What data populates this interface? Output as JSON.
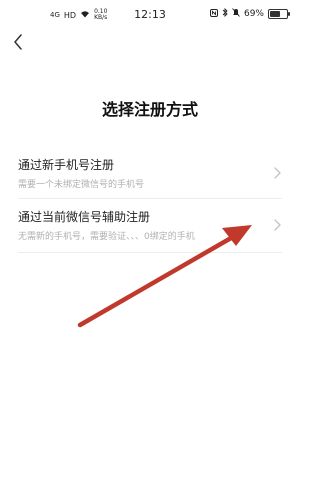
{
  "status_bar": {
    "network": "4G",
    "network_sub": "HD",
    "speed_value": "0.10",
    "speed_unit": "KB/s",
    "time": "12:13",
    "battery": "69%",
    "battery_level": 0.69
  },
  "header": {
    "title": "选择注册方式"
  },
  "options": [
    {
      "title": "通过新手机号注册",
      "desc": "需要一个未绑定微信号的手机号"
    },
    {
      "title": "通过当前微信号辅助注册",
      "desc": "无需新的手机号，需要验证、、、0绑定的手机"
    }
  ],
  "colors": {
    "arrow": "#c0392b",
    "divider": "#ededed",
    "desc_text": "#b0b0b0"
  },
  "icons": {
    "back": "chevron-left-icon",
    "option_chevron": "chevron-right-icon",
    "annotation": "red-arrow-annotation"
  }
}
